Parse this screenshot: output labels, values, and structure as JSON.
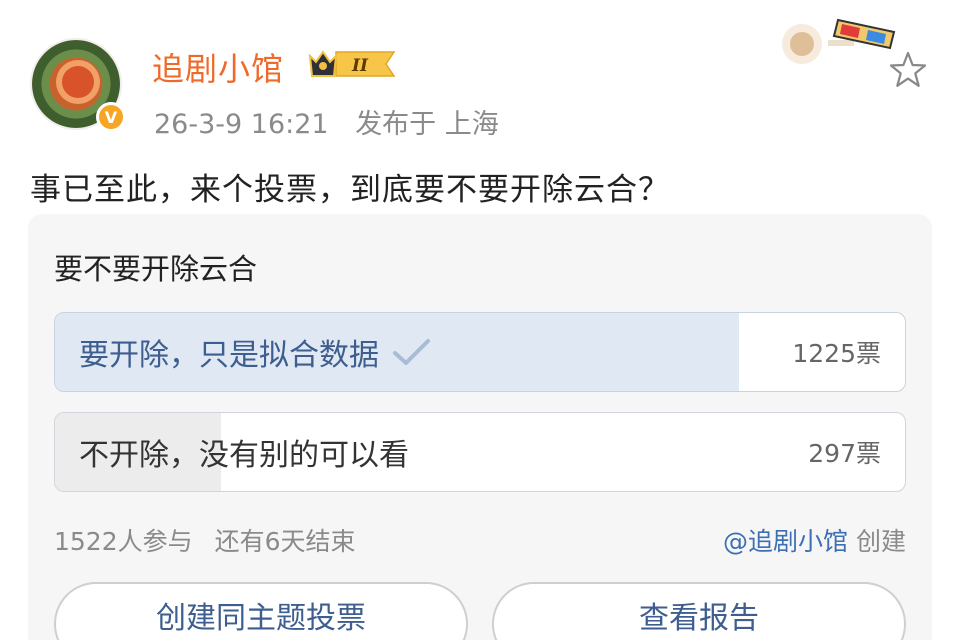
{
  "post": {
    "username": "追剧小馆",
    "level": "II",
    "timestamp": "26-3-9 16:21",
    "location": "发布于 上海",
    "text": "事已至此，来个投票，到底要不要开除云合？"
  },
  "poll": {
    "title": "要不要开除云合",
    "options": [
      {
        "label": "要开除，只是拟合数据",
        "count": "1225票",
        "selected": true,
        "share": 0.805
      },
      {
        "label": "不开除，没有别的可以看",
        "count": "297票",
        "selected": false,
        "share": 0.195
      }
    ],
    "participants": "1522人参与",
    "remaining": "还有6天结束",
    "creator_mention": "@追剧小馆",
    "creator_suffix": "创建",
    "buttons": {
      "create_same": "创建同主题投票",
      "view_report": "查看报告"
    }
  },
  "colors": {
    "username": "#ef6a2a",
    "link": "#3d6fb4",
    "selected_fill": "#e0e8f4",
    "unselected_fill": "#ececec"
  },
  "icons": [
    "verified-badge-icon",
    "level-crown-icon",
    "sticker-3d-glasses-icon",
    "star-icon",
    "check-icon"
  ]
}
